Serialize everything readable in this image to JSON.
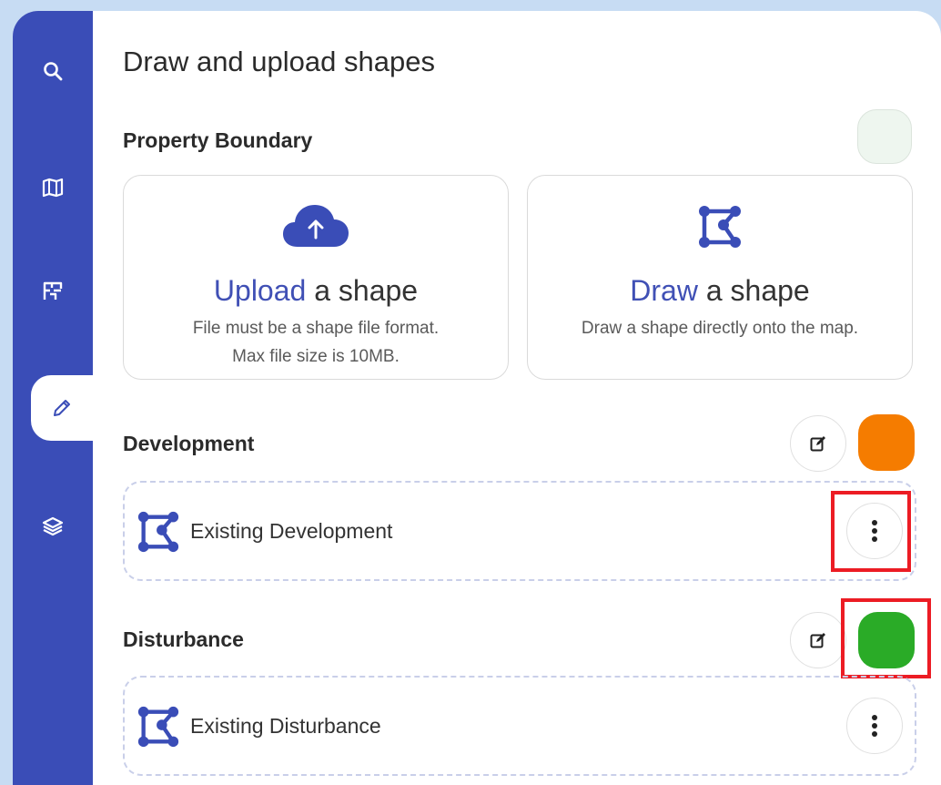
{
  "sidebar": {
    "items": [
      {
        "name": "search",
        "icon": "search-icon"
      },
      {
        "name": "map",
        "icon": "map-icon"
      },
      {
        "name": "floorplan",
        "icon": "floorplan-icon"
      },
      {
        "name": "draw",
        "icon": "pencil-icon",
        "active": true
      },
      {
        "name": "layers",
        "icon": "layers-icon"
      }
    ]
  },
  "main": {
    "title": "Draw and upload shapes",
    "property_boundary": {
      "title": "Property Boundary",
      "color": "#eef6ef",
      "upload_card": {
        "icon": "cloud-upload-icon",
        "link_text": "Upload",
        "rest_text": " a shape",
        "line1": "File must be a shape file format.",
        "line2": "Max file size is 10MB."
      },
      "draw_card": {
        "icon": "polygon-draw-icon",
        "link_text": "Draw",
        "rest_text": " a shape",
        "line1": "Draw a shape directly onto the map."
      }
    },
    "development": {
      "title": "Development",
      "color": "#f57c00",
      "edit_icon": "edit-icon",
      "items": [
        {
          "label": "Existing Development",
          "icon": "polygon-icon"
        }
      ]
    },
    "disturbance": {
      "title": "Disturbance",
      "color": "#2aab27",
      "edit_icon": "edit-icon",
      "items": [
        {
          "label": "Existing Disturbance",
          "icon": "polygon-icon"
        }
      ]
    }
  },
  "colors": {
    "sidebar": "#3a4db7",
    "accent": "#4050b5",
    "highlight": "#ec1c24"
  }
}
